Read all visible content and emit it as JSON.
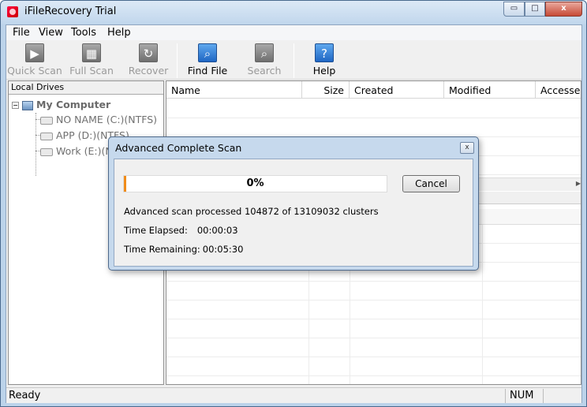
{
  "window": {
    "title": "iFileRecovery Trial",
    "minimize_glyph": "▭",
    "maximize_glyph": "□",
    "close_glyph": "x"
  },
  "menu": [
    "File",
    "View",
    "Tools",
    "Help"
  ],
  "toolbar": {
    "quick_scan": {
      "label": "Quick Scan",
      "icon": "play-icon",
      "glyph": "▶",
      "enabled": false
    },
    "full_scan": {
      "label": "Full Scan",
      "icon": "scan-icon",
      "glyph": "▦",
      "enabled": false
    },
    "recover": {
      "label": "Recover",
      "icon": "recover-icon",
      "glyph": "↻",
      "enabled": false
    },
    "find_file": {
      "label": "Find File",
      "icon": "magnifier-icon",
      "glyph": "⌕",
      "enabled": true
    },
    "search": {
      "label": "Search",
      "icon": "search-icon",
      "glyph": "⌕",
      "enabled": false
    },
    "help": {
      "label": "Help",
      "icon": "help-icon",
      "glyph": "?",
      "enabled": true
    }
  },
  "left_panel": {
    "header": "Local Drives",
    "root": {
      "label": "My Computer",
      "toggle": "−"
    },
    "drives": [
      "NO NAME (C:)(NTFS)",
      "APP (D:)(NTFS)",
      "Work (E:)(NTFS)"
    ]
  },
  "file_list": {
    "columns": [
      "Name",
      "Size",
      "Created",
      "Modified",
      "Accessed"
    ],
    "scroll_arrow": "▶"
  },
  "status": {
    "text": "Ready",
    "num": "NUM"
  },
  "dialog": {
    "title": "Advanced Complete Scan",
    "close_glyph": "x",
    "progress_percent": 0,
    "progress_text": "0%",
    "cancel_label": "Cancel",
    "processed_text": "Advanced scan processed 104872 of 13109032 clusters",
    "elapsed_label": "Time Elapsed:",
    "elapsed_value": "00:00:03",
    "remaining_label": "Time Remaining:",
    "remaining_value": "00:05:30"
  },
  "colors": {
    "accent": "#f08c1a",
    "title_bg": "#c6d9ed"
  }
}
